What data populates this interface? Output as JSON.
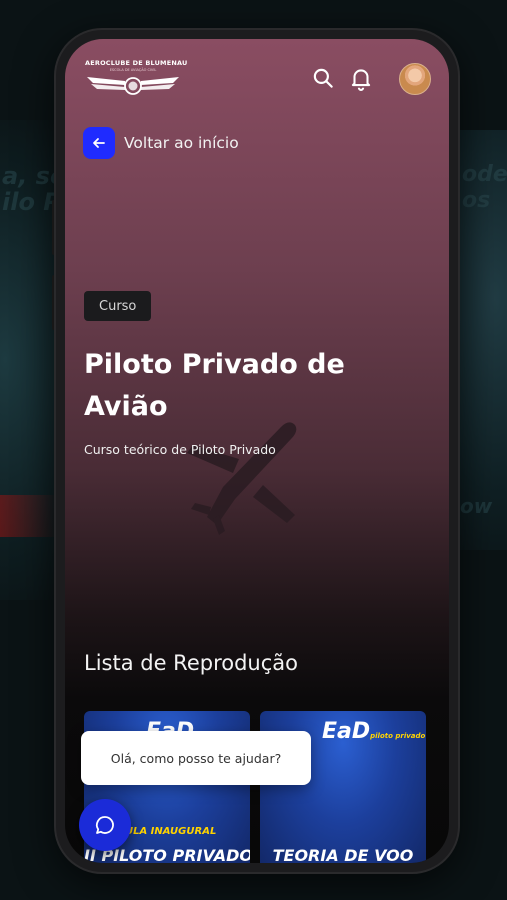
{
  "app": {
    "logo_title": "AEROCLUBE DE BLUMENAU",
    "logo_subtitle": "ESCOLA DE AVIAÇÃO CIVIL"
  },
  "nav": {
    "back_label": "Voltar ao início"
  },
  "course": {
    "badge": "Curso",
    "title": "Piloto Privado de Avião",
    "description": "Curso teórico de Piloto Privado"
  },
  "playlist": {
    "title": "Lista de Reprodução",
    "items": [
      {
        "logo": "EaD",
        "logo_tag": "",
        "kicker": "AULA INAUGURAL",
        "title": "II PILOTO PRIVADO"
      },
      {
        "logo": "EaD",
        "logo_tag": "piloto privado",
        "kicker": "",
        "title": "TEORIA DE VOO"
      }
    ]
  },
  "chat": {
    "greeting": "Olá, como posso te ajudar?"
  },
  "background": {
    "text_left_top": "a, so",
    "text_left_mid": "ilo P",
    "text_right_top": "ode",
    "text_right_mid": "os",
    "text_right_low": "ow"
  },
  "colors": {
    "accent": "#1f2bff",
    "hero_top": "#8a4d62",
    "thumb_blue": "#1c3f9c",
    "thumb_yellow": "#ffd400"
  },
  "icons": [
    "search-icon",
    "bell-icon",
    "arrow-left-icon",
    "chat-icon",
    "plane-silhouette"
  ]
}
